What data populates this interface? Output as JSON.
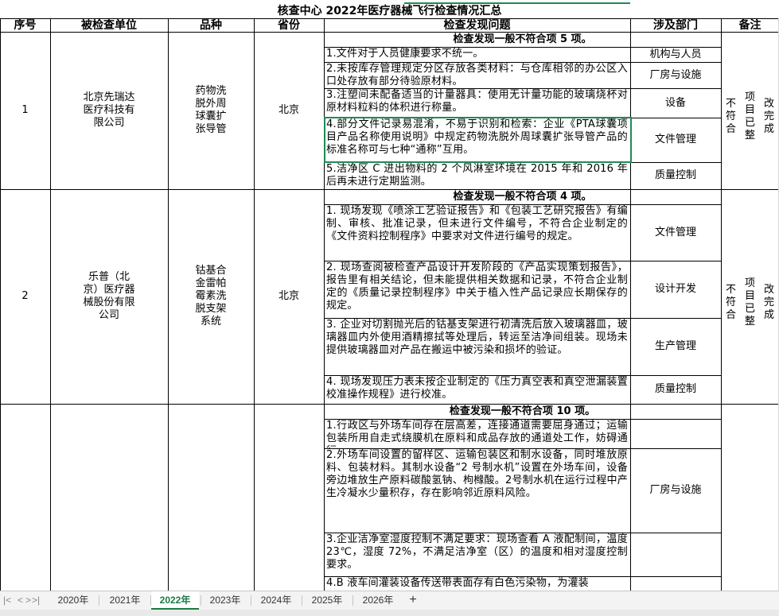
{
  "sheet": {
    "title": "核查中心 2022年医疗器械飞行检查情况汇总",
    "headers": [
      "序号",
      "被检查单位",
      "品种",
      "省份",
      "检查发现问题",
      "涉及部门",
      "备注"
    ],
    "rows": [
      {
        "no": "1",
        "company": "北京先瑞达医疗科技有限公司",
        "product": "药物洗脱外周球囊扩张导管",
        "province": "北京",
        "summary": "检查发现一般不符合项 5 项。",
        "remark": "不符合项目已整改完成",
        "issues": [
          {
            "text": "1.文件对于人员健康要求不统一。",
            "dept": "机构与人员"
          },
          {
            "text": "2.未按库存管理规定分区存放各类材料：与仓库相邻的办公区入口处存放有部分待验原材料。",
            "dept": "厂房与设施"
          },
          {
            "text": "3.注塑间未配备适当的计量器具：使用无计量功能的玻璃烧杯对原材料粒料的体积进行称量。",
            "dept": "设备"
          },
          {
            "text": "4.部分文件记录易混淆，不易于识别和检索：企业《PTA球囊项目产品名称使用说明》中规定药物洗脱外周球囊扩张导管产品的标准名称可与七种“通称”互用。",
            "dept": "文件管理"
          },
          {
            "text": "5.洁净区 C 进出物料的 2 个风淋室环境在 2015 年和 2016 年后再未进行定期监测。",
            "dept": "质量控制"
          }
        ]
      },
      {
        "no": "2",
        "company": "乐普（北京）医疗器械股份有限公司",
        "product": "钴基合金雷帕霉素洗脱支架系统",
        "province": "北京",
        "summary": "检查发现一般不符合项 4 项。",
        "remark": "不符合项目已整改完成",
        "issues": [
          {
            "text": "1. 现场发现《喷涂工艺验证报告》和《包装工艺研究报告》有编制、审核、批准记录，但未进行文件编号，不符合企业制定的《文件资料控制程序》中要求对文件进行编号的规定。",
            "dept": "文件管理"
          },
          {
            "text": "2. 现场查阅被检查产品设计开发阶段的《产品实现策划报告》，报告里有相关结论，但未能提供相关数据和记录，不符合企业制定的《质量记录控制程序》中关于植入性产品记录应长期保存的规定。",
            "dept": "设计开发"
          },
          {
            "text": "3. 企业对切割抛光后的钴基支架进行初清洗后放入玻璃器皿，玻璃器皿内外使用酒精擦拭等处理后，转运至洁净间组装。现场未提供玻璃器皿对产品在搬运中被污染和损坏的验证。",
            "dept": "生产管理"
          },
          {
            "text": "4. 现场发现压力表未按企业制定的《压力真空表和真空泄漏装置校准操作规程》进行校准。",
            "dept": "质量控制"
          }
        ]
      },
      {
        "no": "",
        "company": "",
        "product": "",
        "province": "",
        "summary": "检查发现一般不符合项 10 项。",
        "remark": "",
        "issues": [
          {
            "text": "1.行政区与外场车间存在层高差，连接通道需要屈身通过；运输包装所用自走式绕膜机在原料和成品存放的通道处工作，妨碍通行。",
            "dept": ""
          },
          {
            "text": "2.外场车间设置的留样区、运输包装区和制水设备，同时堆放原料、包装材料。其制水设备“2 号制水机”设置在外场车间，设备旁边堆放生产原料碳酸氢钠、枸橼酸。2号制水机在运行过程中产生冷凝水少量积存，存在影响邻近原料风险。",
            "dept": "厂房与设施"
          },
          {
            "text": "3.企业洁净室湿度控制不满足要求：现场查看 A 液配制间，温度 23℃，湿度 72%，不满足洁净室（区）的温度和相对湿度控制要求。",
            "dept": ""
          },
          {
            "text": "4.B 液车间灌装设备传送带表面存有白色污染物，为灌装",
            "dept": ""
          }
        ]
      }
    ]
  },
  "tabs": {
    "nav_first": "|<",
    "nav_prev": "<",
    "nav_next": ">",
    "nav_last": ">|",
    "items": [
      "2020年",
      "2021年",
      "2022年",
      "2023年",
      "2024年",
      "2025年",
      "2026年"
    ],
    "active": "2022年",
    "add": "+"
  },
  "colors": {
    "selection": "#1f8a55",
    "active_tab": "#1a7a44"
  }
}
